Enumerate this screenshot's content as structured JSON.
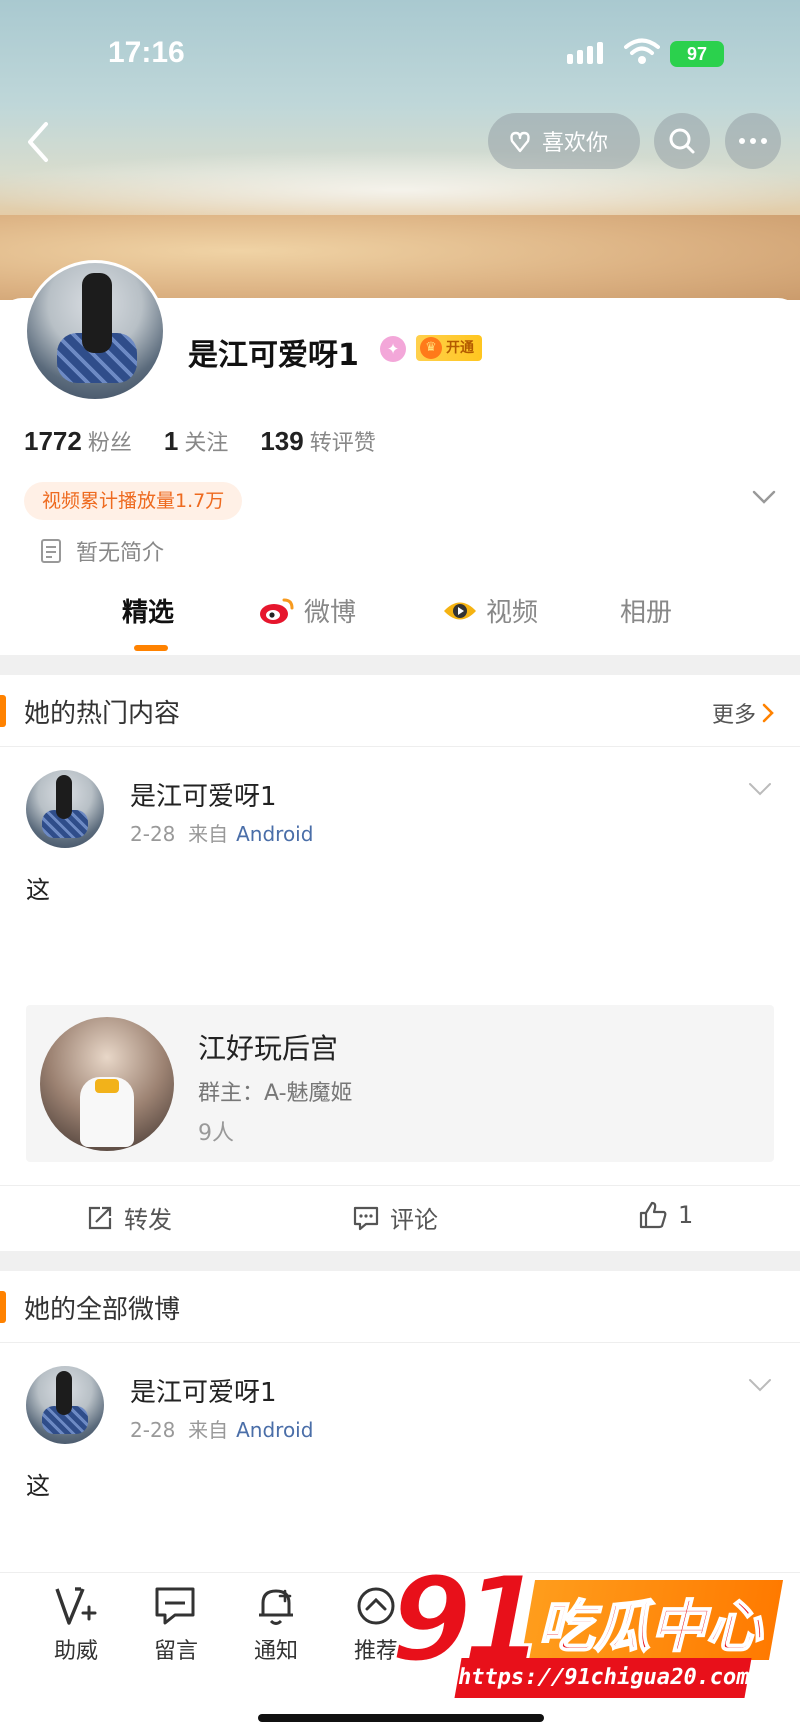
{
  "status_bar": {
    "time": "17:16",
    "battery": "97"
  },
  "header": {
    "like_label": "喜欢你"
  },
  "profile": {
    "name": "是江可爱呀1",
    "vip_label": "开通",
    "stats": [
      {
        "value": "1772",
        "label": "粉丝"
      },
      {
        "value": "1",
        "label": "关注"
      },
      {
        "value": "139",
        "label": "转评赞"
      }
    ],
    "play_badge": "视频累计播放量1.7万",
    "bio": "暂无简介"
  },
  "tabs": [
    {
      "label": "精选",
      "active": true
    },
    {
      "label": "微博"
    },
    {
      "label": "视频"
    },
    {
      "label": "相册"
    }
  ],
  "hot_section": {
    "title": "她的热门内容",
    "more": "更多"
  },
  "hot_post": {
    "author": "是江可爱呀1",
    "date": "2-28",
    "from": "来自",
    "source": "Android",
    "text": "这",
    "group": {
      "name": "江好玩后宫",
      "owner": "群主：A-魅魔姬",
      "count": "9人"
    },
    "actions": {
      "repost": "转发",
      "comment": "评论",
      "like": "1"
    }
  },
  "all_section": {
    "title": "她的全部微博"
  },
  "all_post": {
    "author": "是江可爱呀1",
    "date": "2-28",
    "from": "来自",
    "source": "Android",
    "text": "这"
  },
  "bottom_bar": [
    {
      "label": "助威",
      "icon": "cheer-icon"
    },
    {
      "label": "留言",
      "icon": "message-icon"
    },
    {
      "label": "通知",
      "icon": "bell-icon"
    },
    {
      "label": "推荐",
      "icon": "recommend-icon"
    }
  ],
  "watermark": {
    "number": "91",
    "text": "吃瓜中心",
    "url": "https://91chigua20.com"
  }
}
